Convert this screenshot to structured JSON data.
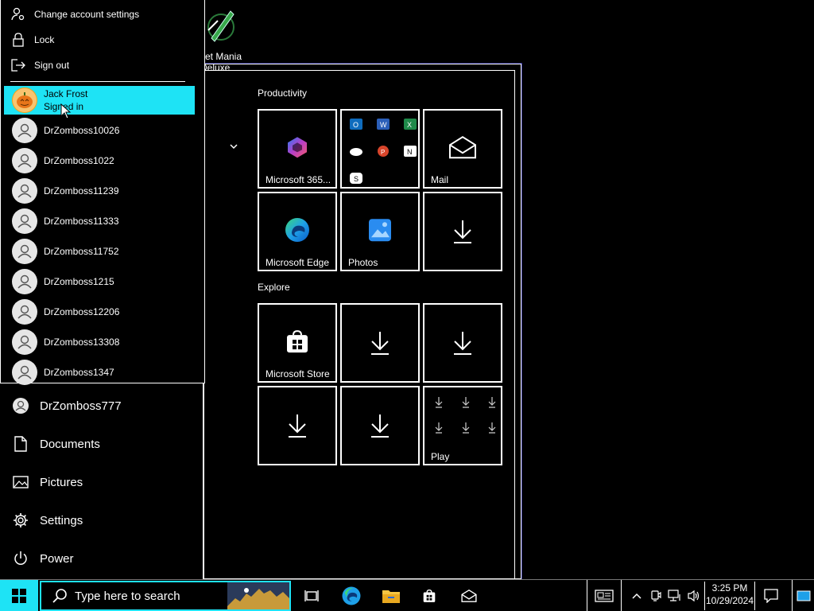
{
  "desktop": {
    "icon_label_line1": "ket Mania",
    "icon_label_line2": "Deluxe"
  },
  "account_flyout": {
    "actions": [
      {
        "label": "Change account settings",
        "icon": "person-gear-icon"
      },
      {
        "label": "Lock",
        "icon": "lock-icon"
      },
      {
        "label": "Sign out",
        "icon": "sign-out-icon"
      }
    ],
    "current_user": {
      "name": "Jack Frost",
      "status": "Signed in"
    },
    "other_users": [
      "DrZomboss10026",
      "DrZomboss1022",
      "DrZomboss11239",
      "DrZomboss11333",
      "DrZomboss11752",
      "DrZomboss1215",
      "DrZomboss12206",
      "DrZomboss13308",
      "DrZomboss1347"
    ]
  },
  "left_rail": {
    "items": [
      {
        "label": "DrZomboss777",
        "icon": "user-avatar-icon"
      },
      {
        "label": "Documents",
        "icon": "document-icon"
      },
      {
        "label": "Pictures",
        "icon": "pictures-icon"
      },
      {
        "label": "Settings",
        "icon": "gear-icon"
      },
      {
        "label": "Power",
        "icon": "power-icon"
      }
    ]
  },
  "tile_groups": {
    "productivity_label": "Productivity",
    "explore_label": "Explore"
  },
  "tiles": {
    "m365": "Microsoft 365...",
    "mail": "Mail",
    "edge": "Microsoft Edge",
    "photos": "Photos",
    "store": "Microsoft Store",
    "play": "Play"
  },
  "taskbar": {
    "search_placeholder": "Type here to search",
    "time": "3:25 PM",
    "date": "10/29/2024",
    "accent_color": "#1ee3f5"
  }
}
